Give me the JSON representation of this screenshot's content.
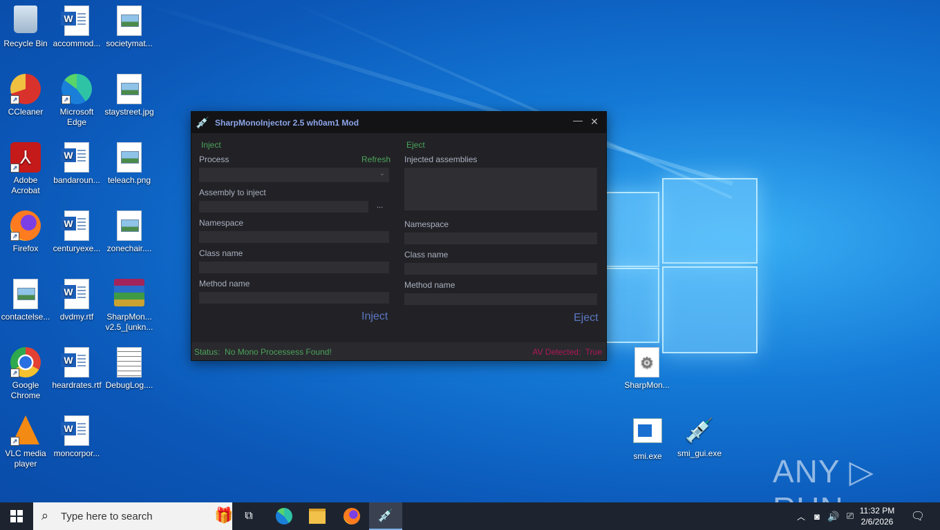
{
  "desktop": {
    "icons": [
      {
        "id": "recycle-bin",
        "label": "Recycle Bin"
      },
      {
        "id": "accommod",
        "label": "accommod..."
      },
      {
        "id": "societymat",
        "label": "societymat..."
      },
      {
        "id": "ccleaner",
        "label": "CCleaner"
      },
      {
        "id": "edge",
        "label": "Microsoft Edge"
      },
      {
        "id": "staystreet",
        "label": "staystreet.jpg"
      },
      {
        "id": "acrobat",
        "label": "Adobe Acrobat"
      },
      {
        "id": "bandaroun",
        "label": "bandaroun..."
      },
      {
        "id": "teleach",
        "label": "teleach.png"
      },
      {
        "id": "firefox",
        "label": "Firefox"
      },
      {
        "id": "centuryexe",
        "label": "centuryexe..."
      },
      {
        "id": "zonechair",
        "label": "zonechair...."
      },
      {
        "id": "contactelse",
        "label": "contactelse..."
      },
      {
        "id": "dvdmy",
        "label": "dvdmy.rtf"
      },
      {
        "id": "sharpmon-rar",
        "label": "SharpMon... v2.5_[unkn..."
      },
      {
        "id": "chrome",
        "label": "Google Chrome"
      },
      {
        "id": "heardrates",
        "label": "heardrates.rtf"
      },
      {
        "id": "debuglog",
        "label": "DebugLog...."
      },
      {
        "id": "vlc",
        "label": "VLC media player"
      },
      {
        "id": "moncorpor",
        "label": "moncorpor..."
      },
      {
        "id": "sharpmon-cfg",
        "label": "SharpMon..."
      },
      {
        "id": "smi",
        "label": "smi.exe"
      },
      {
        "id": "smi-gui",
        "label": "smi_gui.exe"
      }
    ]
  },
  "window": {
    "title": "SharpMonoInjector 2.5 wh0am1 Mod",
    "minimize": "—",
    "close": "✕",
    "inject": {
      "header": "Inject",
      "process_label": "Process",
      "refresh": "Refresh",
      "assembly_label": "Assembly to inject",
      "browse": "...",
      "namespace_label": "Namespace",
      "class_label": "Class name",
      "method_label": "Method name",
      "button": "Inject"
    },
    "eject": {
      "header": "Eject",
      "assemblies_label": "Injected assemblies",
      "namespace_label": "Namespace",
      "class_label": "Class name",
      "method_label": "Method name",
      "button": "Eject"
    },
    "status": {
      "prefix": "Status:",
      "text": "No Mono Processess Found!",
      "av_label": "AV Detected:",
      "av_value": "True"
    }
  },
  "taskbar": {
    "search_placeholder": "Type here to search",
    "time": "11:32 PM",
    "date": "2/6/2026"
  },
  "watermark": "ANY RUN"
}
